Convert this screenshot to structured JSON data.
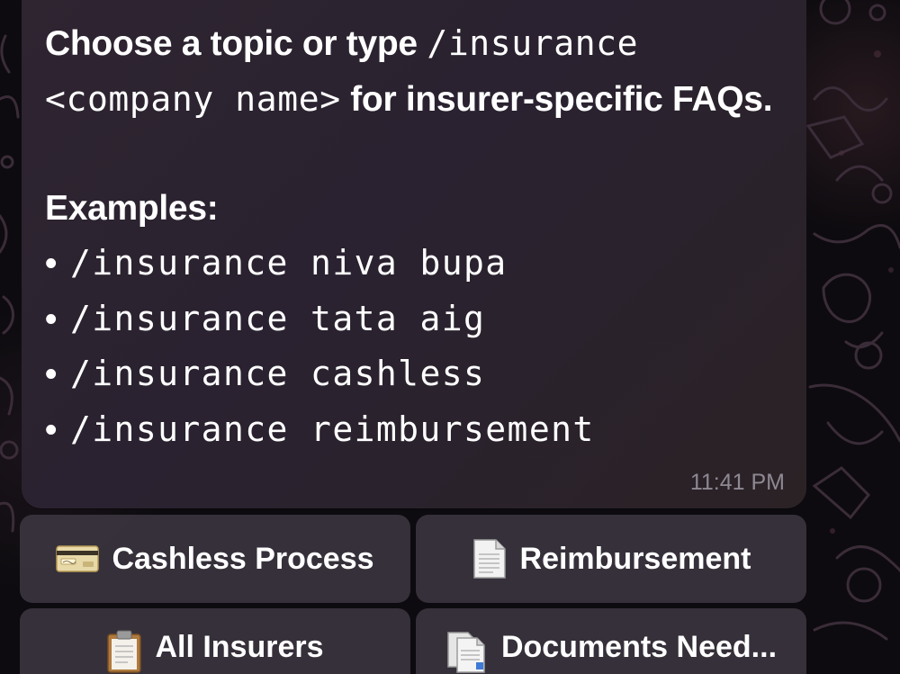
{
  "message": {
    "intro_bold_1": "Choose a topic or type ",
    "intro_code": "/insurance <company name>",
    "intro_bold_2": " for insurer-specific FAQs.",
    "examples_heading": "Examples:",
    "bullet": "•",
    "examples": [
      "/insurance niva bupa",
      "/insurance tata aig",
      "/insurance cashless",
      "/insurance reimbursement"
    ],
    "timestamp": "11:41 PM"
  },
  "keyboard": {
    "buttons": [
      {
        "label": "Cashless Process",
        "icon": "credit-card-icon"
      },
      {
        "label": "Reimbursement",
        "icon": "page-facing-up-icon"
      },
      {
        "label": "All Insurers",
        "icon": "clipboard-icon"
      },
      {
        "label": "Documents Need...",
        "icon": "documents-icon"
      }
    ]
  },
  "colors": {
    "bubble": "#2c2430",
    "button": "#3a343e",
    "text": "#ffffff",
    "timestamp": "#8e8893"
  }
}
